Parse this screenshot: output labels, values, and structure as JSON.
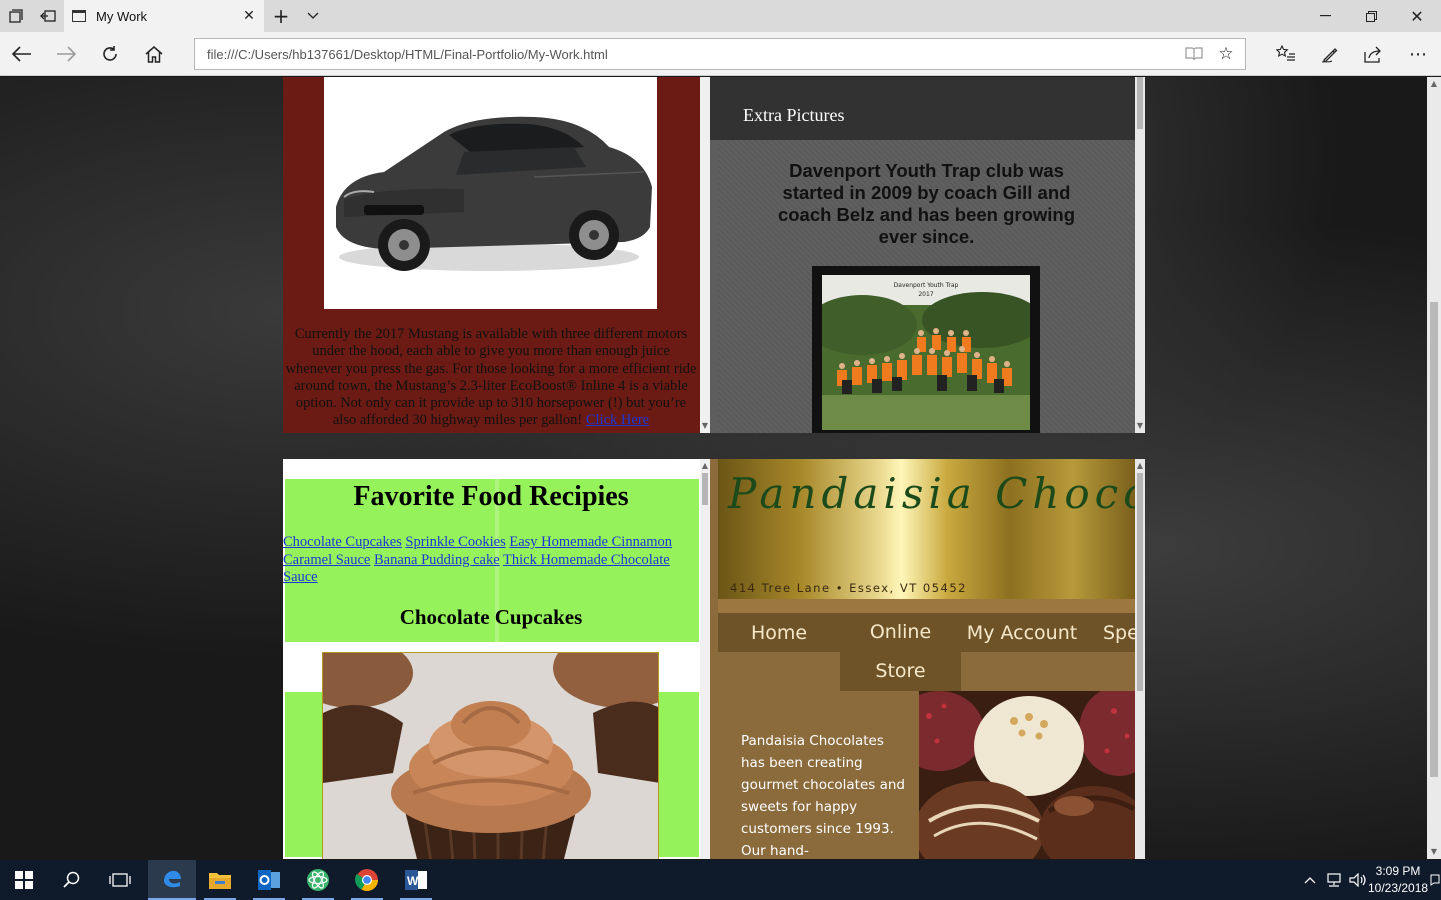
{
  "browser": {
    "tab_title": "My Work",
    "url": "file:///C:/Users/hb137661/Desktop/HTML/Final-Portfolio/My-Work.html"
  },
  "mustang": {
    "description": "Currently the 2017 Mustang is available with three different motors under the hood, each able to give you more than enough juice whenever you press the gas. For those looking for a more efficient ride around town, the Mustang’s 2.3-liter EcoBoost® Inline 4 is a viable option. Not only can it provide up to 310 horsepower (!) but you’re also afforded 30 highway miles per gallon!",
    "link": "Click Here"
  },
  "trap": {
    "header": "Extra Pictures",
    "heading": "Davenport Youth Trap club was started in 2009 by coach Gill and coach Belz and has been growing ever since.",
    "photo_caption_line1": "Davenport Youth Trap",
    "photo_caption_line2": "2017"
  },
  "food": {
    "title": "Favorite Food Recipies",
    "links": [
      "Chocolate Cupcakes",
      "Sprinkle Cookies",
      "Easy Homemade Cinnamon Caramel Sauce",
      "Banana Pudding cake",
      "Thick Homemade Chocolate Sauce"
    ],
    "subtitle": "Chocolate Cupcakes"
  },
  "pandaisia": {
    "brand": "Pandaisia Chocolates",
    "address": "414 Tree Lane • Essex, VT 05452",
    "nav": [
      "Home",
      "Online Store",
      "My Account",
      "Specials"
    ],
    "copy": "Pandaisia Chocolates has been creating gourmet chocolates and sweets for happy customers since 1993. Our hand-"
  },
  "taskbar": {
    "time": "3:09 PM",
    "date": "10/23/2018"
  },
  "colors": {
    "mustang_bg": "#6b1b14",
    "trap_bg": "#5e5e5e",
    "food_green": "#96f25a",
    "choc_brown": "#8b6b3c",
    "link": "#1a37d6"
  }
}
